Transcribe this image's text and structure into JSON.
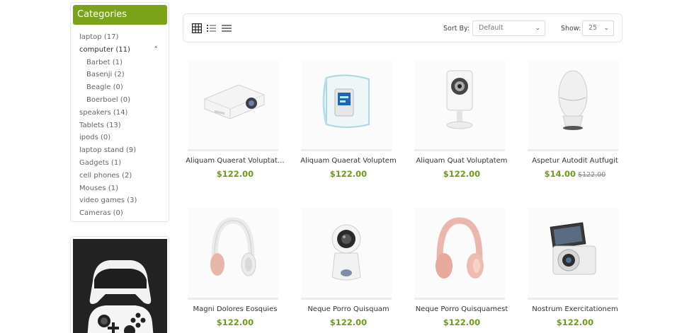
{
  "sidebar": {
    "title": "Categories",
    "items": [
      {
        "label": "laptop (17)",
        "level": 0
      },
      {
        "label": "computer (11)",
        "level": 0,
        "expanded": true
      },
      {
        "label": "Barbet (1)",
        "level": 1
      },
      {
        "label": "Basenji (2)",
        "level": 1
      },
      {
        "label": "Beagle (0)",
        "level": 1
      },
      {
        "label": "Boerboel (0)",
        "level": 1
      },
      {
        "label": "speakers (14)",
        "level": 0
      },
      {
        "label": "Tablets (13)",
        "level": 0
      },
      {
        "label": "ipods (0)",
        "level": 0
      },
      {
        "label": "laptop stand (9)",
        "level": 0
      },
      {
        "label": "Gadgets (1)",
        "level": 0
      },
      {
        "label": "cell phones (2)",
        "level": 0
      },
      {
        "label": "Mouses (1)",
        "level": 0
      },
      {
        "label": "video games (3)",
        "level": 0
      },
      {
        "label": "Cameras (0)",
        "level": 0
      }
    ]
  },
  "toolbar": {
    "views": [
      "grid-view-icon",
      "list-view-icon",
      "compact-list-icon"
    ],
    "sort_label": "Sort By:",
    "sort_value": "Default",
    "show_label": "Show:",
    "show_value": "25"
  },
  "products": [
    {
      "name": "Aliquam Quaerat Voluptat…",
      "price": "$122.00",
      "old_price": "",
      "icon": "projector"
    },
    {
      "name": "Aliquam Quaerat Voluptem",
      "price": "$122.00",
      "old_price": "",
      "icon": "blood-pressure-monitor"
    },
    {
      "name": "Aliquam Quat Voluptatem",
      "price": "$122.00",
      "old_price": "",
      "icon": "webcam"
    },
    {
      "name": "Aspetur Autodit Autfugit",
      "price": "$14.00",
      "old_price": "$122.00",
      "icon": "smart-speaker"
    },
    {
      "name": "Magni Dolores Eosquies",
      "price": "$122.00",
      "old_price": "",
      "icon": "headphones-white"
    },
    {
      "name": "Neque Porro Quisquam",
      "price": "$122.00",
      "old_price": "",
      "icon": "360-camera"
    },
    {
      "name": "Neque Porro Quisquamest",
      "price": "$122.00",
      "old_price": "",
      "icon": "headphones-pink"
    },
    {
      "name": "Nostrum Exercitationem",
      "price": "$122.00",
      "old_price": "",
      "icon": "compact-camera"
    }
  ],
  "colors": {
    "accent": "#7aa31a",
    "price": "#6e9a1c"
  }
}
